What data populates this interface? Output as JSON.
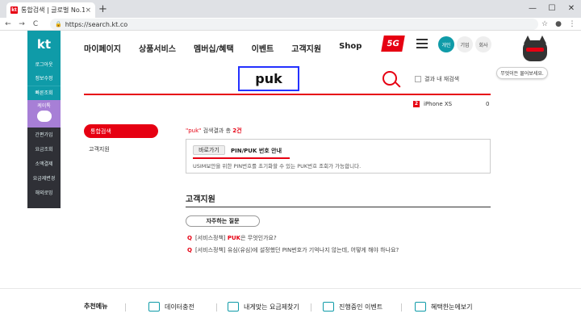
{
  "browser": {
    "tab_title": "통합검색 | 글로벌 No.1 KT",
    "tab_favicon": "kt",
    "url": "https://search.kt.co",
    "back": "←",
    "forward": "→",
    "reload": "C",
    "close_tab": "×",
    "new_tab": "+",
    "win_min": "—",
    "win_max": "☐",
    "win_close": "✕",
    "star": "☆",
    "profile": "●",
    "menu": "⋮"
  },
  "sidebar": {
    "logo": "kt",
    "items": [
      "로그아웃",
      "정보수정",
      "빠른조회"
    ],
    "mascot_label": "케이톡",
    "links": [
      "간편가입",
      "요금조회",
      "소액결제",
      "요금제변경",
      "해외로밍"
    ]
  },
  "gnb": {
    "menus": [
      "마이페이지",
      "상품서비스",
      "멤버십/혜택",
      "이벤트",
      "고객지원",
      "Shop"
    ],
    "badge_5g": "5G",
    "segments": [
      "개인",
      "기업",
      "회사"
    ]
  },
  "chatbot": {
    "bubble": "무엇이든 물어보세요."
  },
  "search": {
    "query": "puk",
    "option_label": "결과 내 재검색"
  },
  "cart": {
    "count_badge": "2",
    "item": "iPhone XS",
    "value": "0"
  },
  "left_tabs": [
    "통합검색",
    "고객지원"
  ],
  "results": {
    "summary_query": "\"puk\"",
    "summary_text": " 검색결과 총 ",
    "summary_count": "2건",
    "shortcut_button": "바로가기",
    "link_title": "PIN/PUK 번호 안내",
    "description": "USIM보안을 위한 PIN번호를 초기화할 수 있는 PUK번호 조회가 가능합니다."
  },
  "support": {
    "heading": "고객지원",
    "faq_pill": "자주하는 질문",
    "questions": [
      {
        "mark": "Q",
        "prefix": "[서비스정책] ",
        "emph": "PUK",
        "suffix": "은 무엇인가요?"
      },
      {
        "mark": "Q",
        "prefix": "[서비스정책] 유심(유심)에 설정했던 PIN번호가 기억나지 않는데, 어떻게 해야 하나요?",
        "emph": "",
        "suffix": ""
      }
    ]
  },
  "footer": {
    "label": "추천메뉴",
    "items": [
      "데이터충전",
      "내게맞는 요금제찾기",
      "진행중인 이벤트",
      "혜택한눈에보기"
    ]
  },
  "colors": {
    "brand_red": "#e60012",
    "kt_teal": "#0f9ba8",
    "focus_blue": "#2431ff"
  }
}
